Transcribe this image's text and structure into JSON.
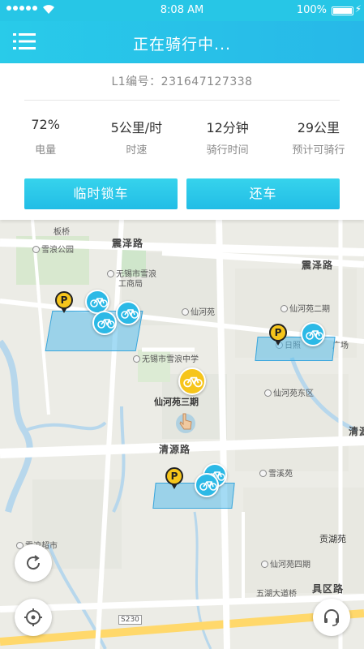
{
  "status_bar": {
    "time": "8:08 AM",
    "battery": "100%"
  },
  "nav": {
    "title": "正在骑行中..."
  },
  "ride": {
    "bike_id": "L1编号：231647127338"
  },
  "stats": [
    {
      "value": "72%",
      "label": "电量"
    },
    {
      "value": "5公里/时",
      "label": "时速"
    },
    {
      "value": "12分钟",
      "label": "骑行时间"
    },
    {
      "value": "29公里",
      "label": "预计可骑行"
    }
  ],
  "buttons": {
    "temp_lock": "临时锁车",
    "return": "还车"
  },
  "map": {
    "roads": [
      "震泽路",
      "震泽路",
      "清源路",
      "清源",
      "贡湖苑",
      "五湖大道桥",
      "具区路",
      "S230",
      "板桥"
    ],
    "pois": [
      "雪浪公园",
      "无锡市雪浪",
      "工商局",
      "仙河苑",
      "仙河苑二期",
      "日照",
      "广场",
      "无锡市雪浪中学",
      "仙河苑东区",
      "仙河苑三期",
      "雪溪苑",
      "仙河苑四期",
      "雪浪超市"
    ],
    "bike_marker_symbol": "P"
  },
  "colors": {
    "primary": "#27c6e6",
    "zone": "#5abeeb",
    "parking": "#f6c51b"
  }
}
